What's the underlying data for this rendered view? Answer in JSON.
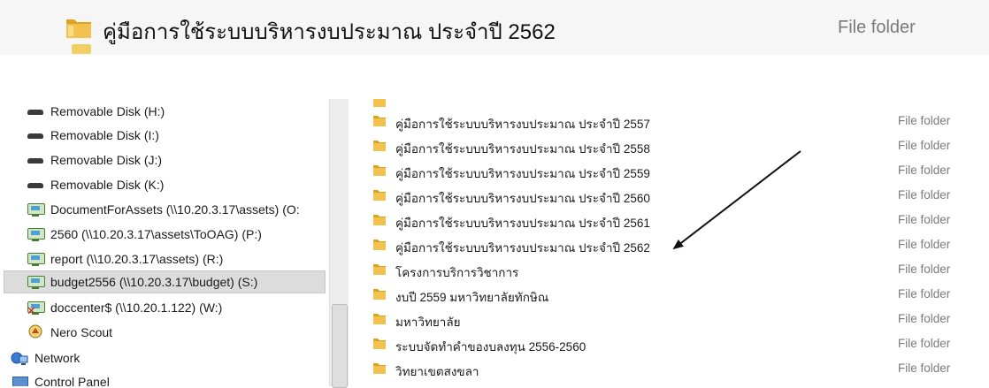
{
  "zoom_row": {
    "name": "คู่มือการใช้ระบบบริหารงบประมาณ ประจำปี 2562",
    "type": "File folder"
  },
  "nav": {
    "items": [
      {
        "label": "Removable Disk (H:)",
        "icon": "removable-disk-icon"
      },
      {
        "label": "Removable Disk (I:)",
        "icon": "removable-disk-icon"
      },
      {
        "label": "Removable Disk (J:)",
        "icon": "removable-disk-icon"
      },
      {
        "label": "Removable Disk (K:)",
        "icon": "removable-disk-icon"
      },
      {
        "label": "DocumentForAssets (\\\\10.20.3.17\\assets) (O:",
        "icon": "network-drive-icon"
      },
      {
        "label": "2560 (\\\\10.20.3.17\\assets\\ToOAG) (P:)",
        "icon": "network-drive-icon"
      },
      {
        "label": "report (\\\\10.20.3.17\\assets) (R:)",
        "icon": "network-drive-icon"
      },
      {
        "label": "budget2556 (\\\\10.20.3.17\\budget) (S:)",
        "icon": "network-drive-icon",
        "selected": true
      },
      {
        "label": "doccenter$ (\\\\10.20.1.122) (W:)",
        "icon": "disconnected-network-drive-icon"
      },
      {
        "label": "Nero Scout",
        "icon": "nero-scout-icon"
      },
      {
        "label": "Network",
        "icon": "network-icon"
      },
      {
        "label": "Control Panel",
        "icon": "control-panel-icon"
      }
    ]
  },
  "files": {
    "type_label": "File folder",
    "rows": [
      {
        "name": "คู่มือการใช้ระบบบริหารงบประมาณ ประจำปี 2557",
        "type": "File folder"
      },
      {
        "name": "คู่มือการใช้ระบบบริหารงบประมาณ ประจำปี 2558",
        "type": "File folder"
      },
      {
        "name": "คู่มือการใช้ระบบบริหารงบประมาณ ประจำปี 2559",
        "type": "File folder"
      },
      {
        "name": "คู่มือการใช้ระบบบริหารงบประมาณ ประจำปี 2560",
        "type": "File folder"
      },
      {
        "name": "คู่มือการใช้ระบบบริหารงบประมาณ ประจำปี 2561",
        "type": "File folder"
      },
      {
        "name": "คู่มือการใช้ระบบบริหารงบประมาณ ประจำปี 2562",
        "type": "File folder"
      },
      {
        "name": "โครงการบริการวิชาการ",
        "type": "File folder"
      },
      {
        "name": "งบปี 2559 มหาวิทยาลัยทักษิณ",
        "type": "File folder"
      },
      {
        "name": "มหาวิทยาลัย",
        "type": "File folder"
      },
      {
        "name": "ระบบจัดทำคำของบลงทุน 2556-2560",
        "type": "File folder"
      },
      {
        "name": "วิทยาเขตสงขลา",
        "type": "File folder"
      }
    ]
  },
  "colors": {
    "folder": "#f2c14e",
    "folder_dark": "#d9a520",
    "selected_bg": "#dcdcdc",
    "type_text": "#7a7a7a"
  }
}
